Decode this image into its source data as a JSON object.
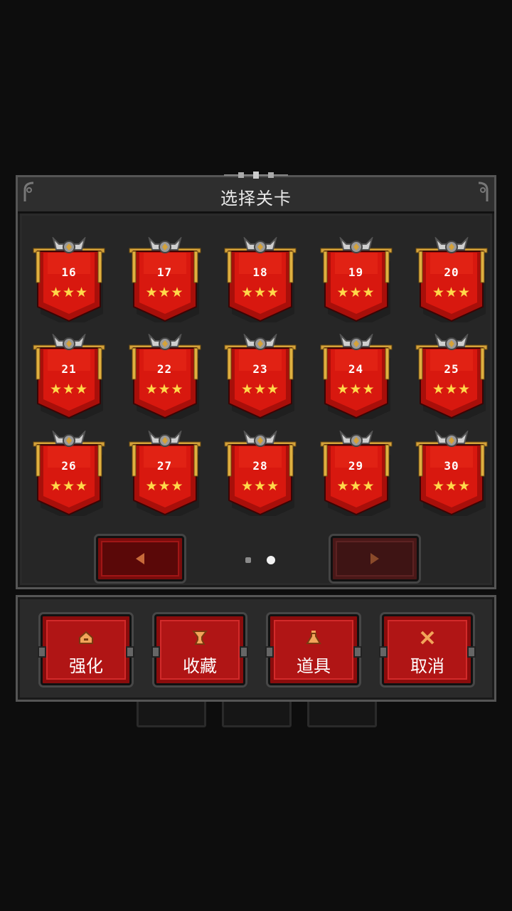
{
  "title": "选择关卡",
  "levels": [
    {
      "number": "16",
      "stars": "★★★"
    },
    {
      "number": "17",
      "stars": "★★★"
    },
    {
      "number": "18",
      "stars": "★★★"
    },
    {
      "number": "19",
      "stars": "★★★"
    },
    {
      "number": "20",
      "stars": "★★★"
    },
    {
      "number": "21",
      "stars": "★★★"
    },
    {
      "number": "22",
      "stars": "★★★"
    },
    {
      "number": "23",
      "stars": "★★★"
    },
    {
      "number": "24",
      "stars": "★★★"
    },
    {
      "number": "25",
      "stars": "★★★"
    },
    {
      "number": "26",
      "stars": "★★★"
    },
    {
      "number": "27",
      "stars": "★★★"
    },
    {
      "number": "28",
      "stars": "★★★"
    },
    {
      "number": "29",
      "stars": "★★★"
    },
    {
      "number": "30",
      "stars": "★★★"
    }
  ],
  "pager": {
    "current_page": 2,
    "total_pages": 2
  },
  "actions": [
    {
      "label": "强化",
      "icon": "upgrade-icon"
    },
    {
      "label": "收藏",
      "icon": "trophy-icon"
    },
    {
      "label": "道具",
      "icon": "potion-icon"
    },
    {
      "label": "取消",
      "icon": "close-icon"
    }
  ],
  "colors": {
    "banner": "#c8160f",
    "star": "#ffd84a",
    "button": "#b01515",
    "panel": "#2a2a2a"
  }
}
